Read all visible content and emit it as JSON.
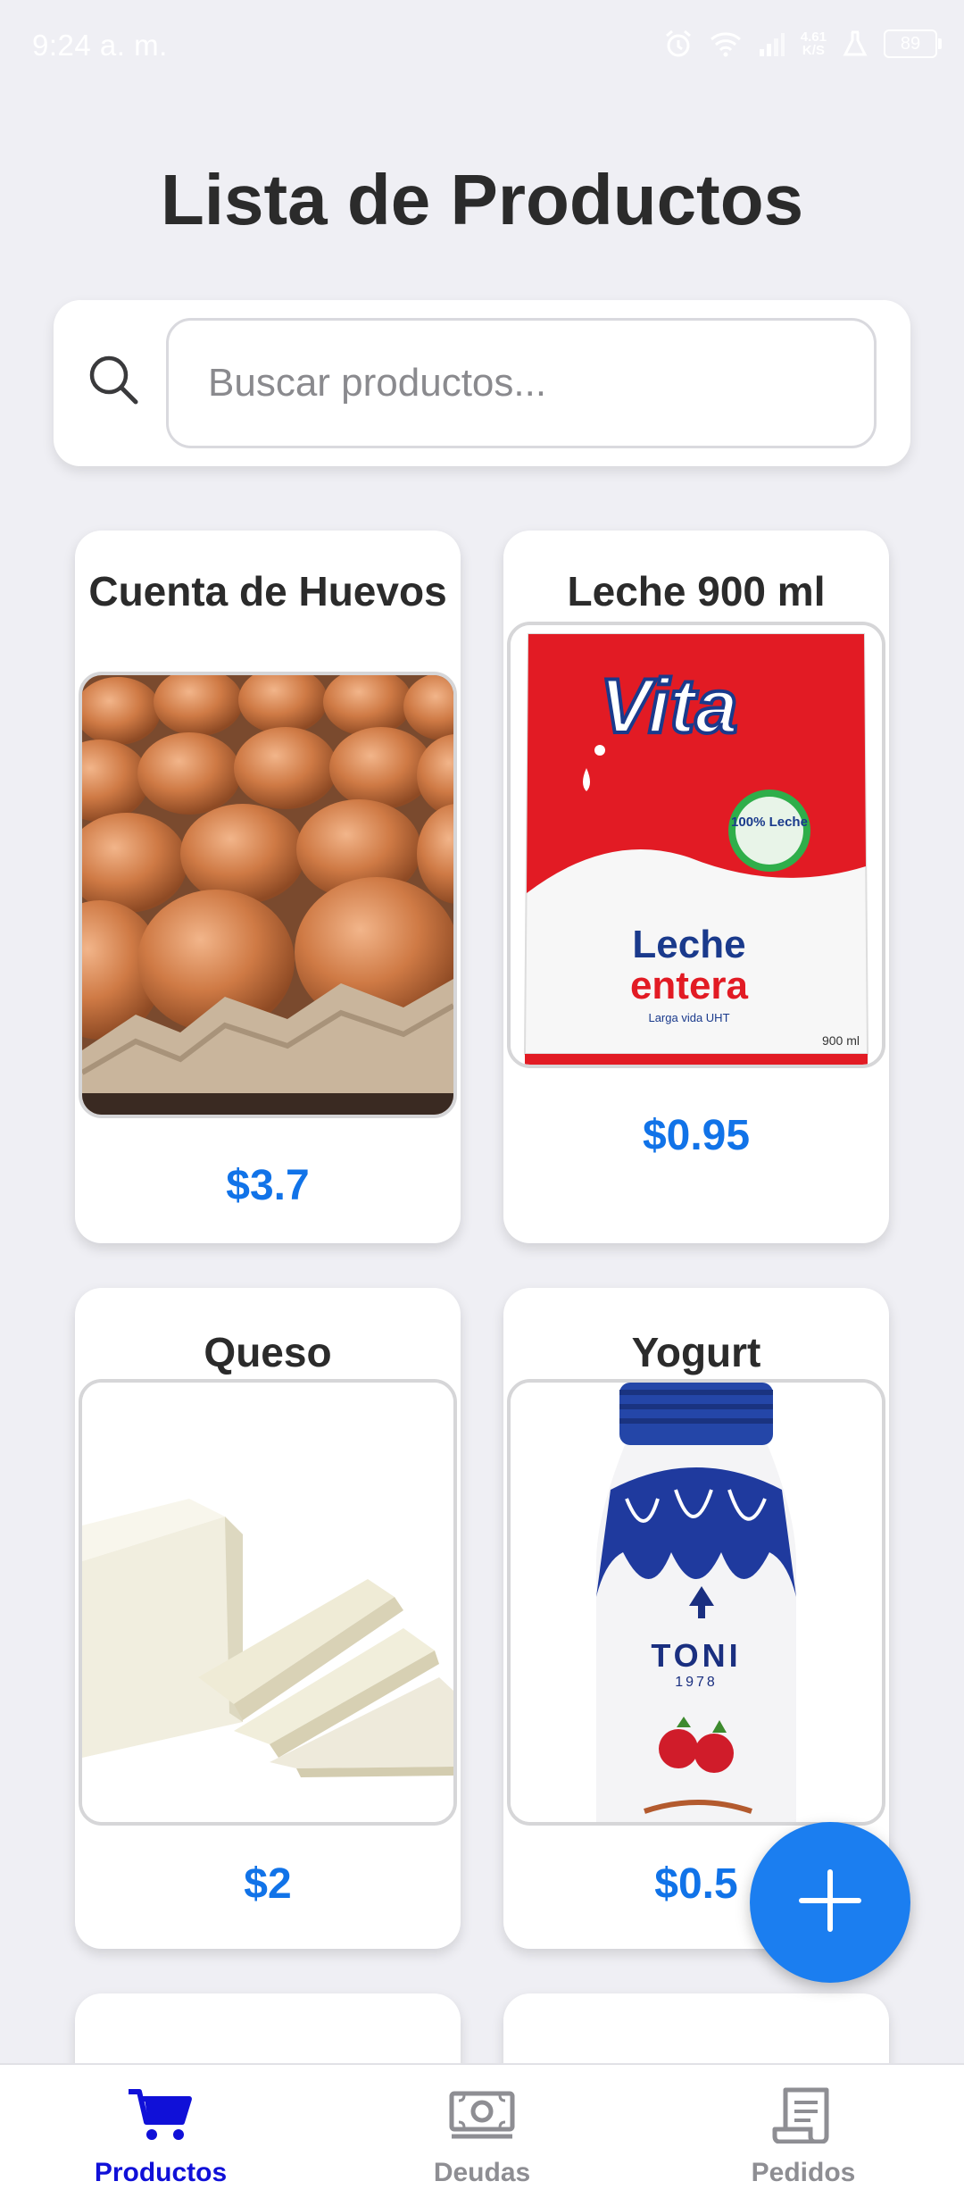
{
  "status_bar": {
    "time": "9:24 a. m.",
    "net_speed": "4.61",
    "net_unit": "K/S",
    "battery": "89"
  },
  "page": {
    "title": "Lista de Productos"
  },
  "search": {
    "placeholder": "Buscar productos...",
    "icon": "search-icon"
  },
  "products": [
    {
      "name": "Cuenta de Huevos",
      "price": "$3.7",
      "image": "eggs-in-carton"
    },
    {
      "name": "Leche 900 ml",
      "price": "$0.95",
      "image": "vita-milk-bag"
    },
    {
      "name": "Queso",
      "price": "$2",
      "image": "white-cheese-slices"
    },
    {
      "name": "Yogurt",
      "price": "$0.5",
      "image": "toni-yogurt-bottle"
    }
  ],
  "product_image_text": {
    "milk_brand": "Vita",
    "milk_line1": "Leche",
    "milk_line2": "entera",
    "milk_line3": "Larga vida UHT",
    "milk_badge": "100% Leche",
    "milk_net": "900 ml",
    "yogurt_brand": "TONI",
    "yogurt_year": "1978"
  },
  "fab": {
    "icon": "plus-icon"
  },
  "bottom_nav": [
    {
      "label": "Productos",
      "icon": "cart-icon",
      "active": true
    },
    {
      "label": "Deudas",
      "icon": "money-icon",
      "active": false
    },
    {
      "label": "Pedidos",
      "icon": "receipt-icon",
      "active": false
    }
  ],
  "colors": {
    "accent": "#1173e8",
    "nav_active": "#1010d8",
    "nav_inactive": "#8e8e93",
    "background": "#efeff4"
  }
}
